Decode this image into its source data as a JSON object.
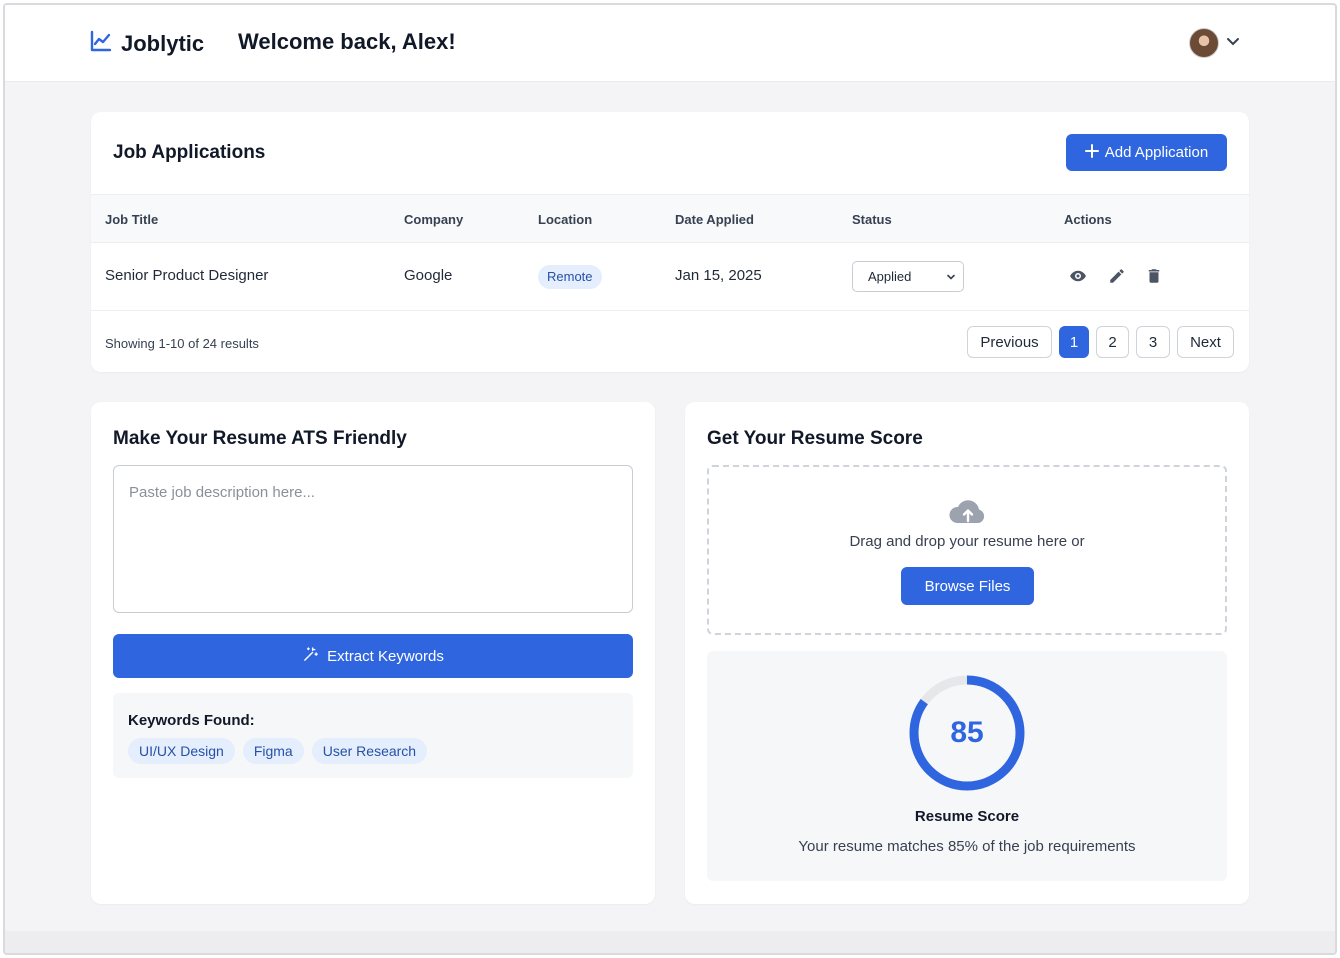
{
  "app": {
    "name": "Joblytic",
    "welcome": "Welcome back, Alex!"
  },
  "header": {
    "user_avatar": "avatar",
    "menu_icon": "chevron-down-icon"
  },
  "colors": {
    "primary": "#2f66e0",
    "badge_bg": "#e5eefc",
    "badge_text": "#2750a8"
  },
  "jobs": {
    "title": "Job Applications",
    "add_label": "Add Application",
    "columns": [
      "Job Title",
      "Company",
      "Location",
      "Date Applied",
      "Status",
      "Actions"
    ],
    "rows": [
      {
        "title": "Senior Product Designer",
        "company": "Google",
        "location": "Remote",
        "date": "Jan 15, 2025",
        "status": "Applied"
      }
    ],
    "footer": "Showing 1-10 of 24 results",
    "pagination": {
      "prev": "Previous",
      "pages": [
        "1",
        "2",
        "3"
      ],
      "current": "1",
      "next": "Next"
    }
  },
  "ats": {
    "title": "Make Your Resume ATS Friendly",
    "placeholder": "Paste job description here...",
    "extract_label": "Extract Keywords",
    "keywords_title": "Keywords Found:",
    "keywords": [
      "UI/UX Design",
      "Figma",
      "User Research"
    ]
  },
  "score": {
    "title": "Get Your Resume Score",
    "drop_text": "Drag and drop your resume here or",
    "browse_label": "Browse Files",
    "value": 85,
    "value_text": "85",
    "label": "Resume Score",
    "description": "Your resume matches 85% of the job requirements"
  }
}
